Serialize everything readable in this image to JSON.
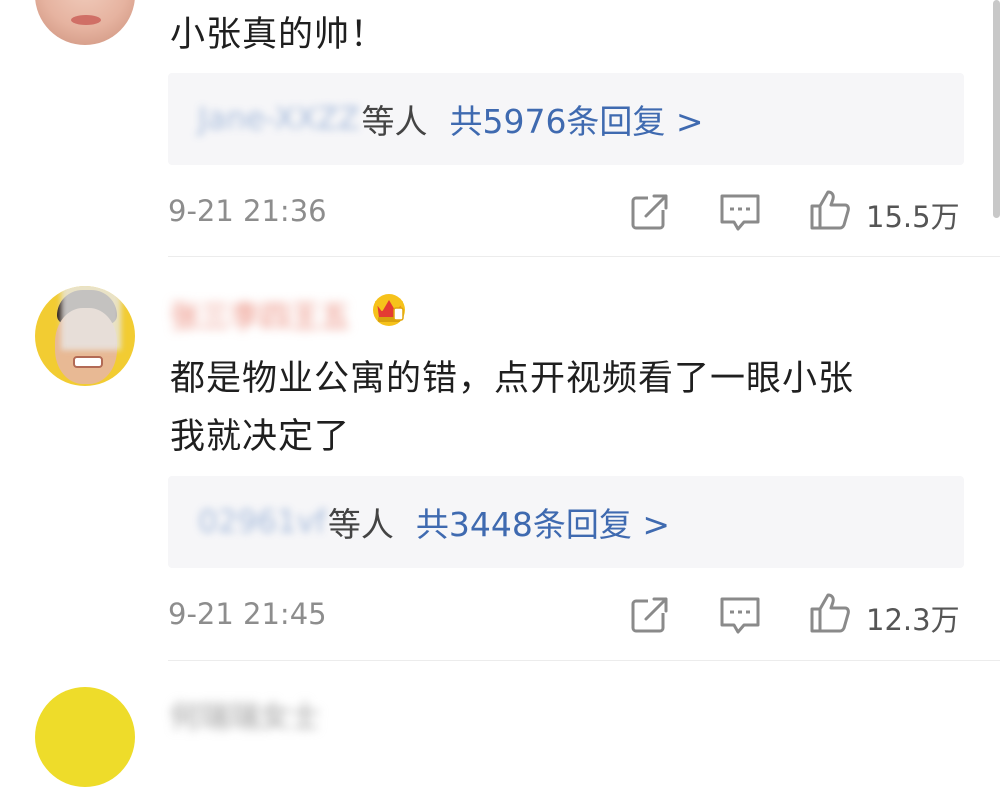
{
  "comments": [
    {
      "text": "小张真的帅！",
      "reply_preview_name": "Jane-XXZZ",
      "reply_others": "等人",
      "reply_total": "共5976条回复 >",
      "time": "9-21 21:36",
      "likes": "15.5万"
    },
    {
      "username": "张三李四王五",
      "text_line1": "都是物业公寓的错，点开视频看了一眼小张",
      "text_line2": "我就决定了",
      "reply_preview_name": "02961vf",
      "reply_others": "等人",
      "reply_total": "共3448条回复 >",
      "time": "9-21 21:45",
      "likes": "12.3万"
    },
    {
      "username": "何瑞瑞女士"
    }
  ],
  "colors": {
    "link_blue": "#3f6ab0",
    "reply_bg": "#f6f6f8",
    "meta_gray": "#8d8d8d"
  }
}
